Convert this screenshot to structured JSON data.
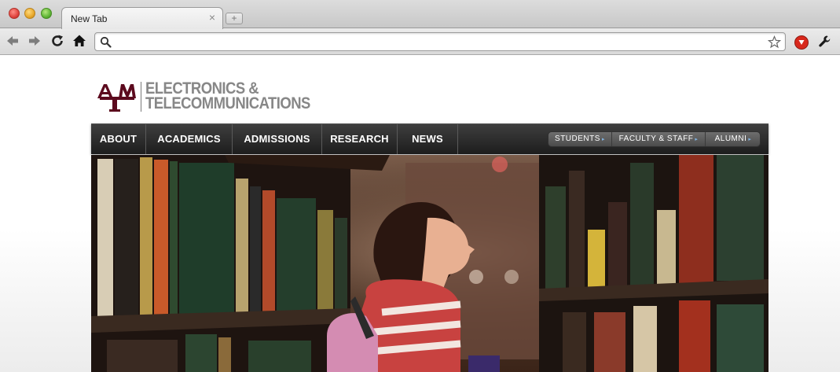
{
  "browser": {
    "tab_title": "New Tab",
    "tab_close": "×",
    "new_tab": "+",
    "address_value": "",
    "address_placeholder": ""
  },
  "logo": {
    "mark_letters": "ATM",
    "line1": "ELECTRONICS &",
    "line2": "TELECOMMUNICATIONS",
    "brand_color": "#5c0a1e"
  },
  "nav": {
    "items": [
      "ABOUT",
      "ACADEMICS",
      "ADMISSIONS",
      "RESEARCH",
      "NEWS"
    ],
    "secondary": [
      "STUDENTS",
      "FACULTY & STAFF",
      "ALUMNI"
    ],
    "secondary_arrow": "▸"
  },
  "hero": {
    "icon": "library-photo-icon"
  },
  "colors": {
    "navbar": "#262626",
    "logo_gray": "#878787",
    "secondary_arrow": "#7fb2e0"
  }
}
